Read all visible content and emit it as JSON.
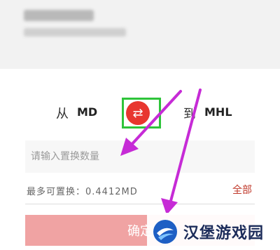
{
  "swap": {
    "from_label": "从",
    "from_code": "MD",
    "to_label": "到",
    "to_code": "MHL",
    "swap_icon": "⇄"
  },
  "amount_input": {
    "placeholder": "请输入置换数量",
    "value": ""
  },
  "info": {
    "max_text": "最多可置换：0.4412MD",
    "all_label": "全部"
  },
  "confirm": {
    "label": "确定"
  },
  "watermark": {
    "text": "汉堡游戏园"
  },
  "colors": {
    "swap_button": "#e8362f",
    "highlight_box": "#2ec43a",
    "arrow": "#c62bd6",
    "confirm_button": "#f0a3a3"
  }
}
